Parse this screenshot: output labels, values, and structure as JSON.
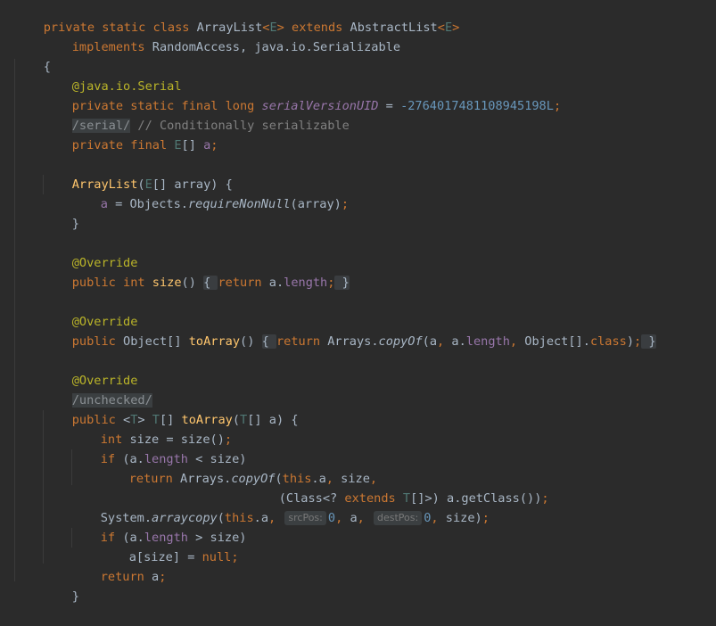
{
  "editor": {
    "language": "Java",
    "code": {
      "l1": {
        "kw1": "private static class ",
        "cls": "ArrayList",
        "gen_open": "<",
        "e": "E",
        "gen_close": "> ",
        "kw2": "extends ",
        "parent": "AbstractList",
        "gen_open2": "<",
        "e2": "E",
        "gen_close2": ">"
      },
      "l2": {
        "kw": "implements ",
        "rest": "RandomAccess, java.io.Serializable"
      },
      "l3": {
        "brace": "{"
      },
      "l4": {
        "ann": "@java.io.Serial"
      },
      "l5": {
        "kw": "private static final long ",
        "field": "serialVersionUID",
        "eq": " = ",
        "num": "-2764017481108945198L",
        "semi": ";"
      },
      "l6": {
        "sup": "/serial/",
        "comment": " // Conditionally serializable"
      },
      "l7": {
        "kw": "private final ",
        "e": "E",
        "brackets": "[] ",
        "field": "a",
        "semi": ";"
      },
      "l8": {
        "ctor": "ArrayList",
        "open": "(",
        "e": "E",
        "rest": "[] array) {"
      },
      "l9": {
        "field": "a",
        "mid": " = Objects.",
        "method": "requireNonNull",
        "rest": "(array)",
        "semi": ";"
      },
      "l10": {
        "brace": "}"
      },
      "l11": {
        "ann": "@Override"
      },
      "l12": {
        "kw": "public int ",
        "fn": "size",
        "paren": "() ",
        "fold1": "{ ",
        "kw2": "return ",
        "a": "a.",
        "length": "length",
        "semi": ";",
        "fold2": " }"
      },
      "l13": {
        "ann": "@Override"
      },
      "l14": {
        "kw": "public ",
        "type": "Object[] ",
        "fn": "toArray",
        "paren": "() ",
        "fold1": "{ ",
        "kw2": "return ",
        "cls": "Arrays.",
        "method": "copyOf",
        "args1": "(a",
        "comma1": ", ",
        "a2": "a.",
        "length": "length",
        "comma2": ", ",
        "obj": "Object[].",
        "classkw": "class",
        "close": ")",
        "semi": ";",
        "fold2": " }"
      },
      "l15": {
        "ann": "@Override"
      },
      "l16": {
        "sup": "/unchecked/"
      },
      "l17": {
        "kw": "public ",
        "open": "<",
        "t": "T",
        "close": "> ",
        "t2": "T",
        "rest1": "[] ",
        "fn": "toArray",
        "paren": "(",
        "t3": "T",
        "rest2": "[] a) {"
      },
      "l18": {
        "kw": "int ",
        "rest": "size = size()",
        "semi": ";"
      },
      "l19": {
        "kw": "if ",
        "rest1": "(a.",
        "length": "length",
        "rest2": " < size)"
      },
      "l20": {
        "kw": "return ",
        "cls": "Arrays.",
        "method": "copyOf",
        "open": "(",
        "this": "this",
        "rest1": ".a",
        "comma": ", ",
        "rest2": "size",
        "comma2": ","
      },
      "l21": {
        "rest1": "(Class<? ",
        "kw": "extends ",
        "t": "T",
        "rest2": "[]>) a.getClass())",
        "semi": ";"
      },
      "l22": {
        "cls": "System.",
        "method": "arraycopy",
        "open": "(",
        "this": "this",
        "rest1": ".a",
        "comma1": ", ",
        "hint1": "srcPos:",
        "n1": "0",
        "comma2": ", ",
        "a": "a",
        "comma3": ", ",
        "hint2": "destPos:",
        "n2": "0",
        "comma4": ", ",
        "size": "size)",
        "semi": ";"
      },
      "l23": {
        "kw": "if ",
        "rest1": "(a.",
        "length": "length",
        "rest2": " > size)"
      },
      "l24": {
        "rest": "a[size] = ",
        "kw": "null",
        "semi": ";"
      },
      "l25": {
        "kw": "return ",
        "rest": "a",
        "semi": ";"
      },
      "l26": {
        "brace": "}"
      }
    }
  },
  "colors": {
    "background": "#2b2b2b",
    "keyword": "#cc7832",
    "annotation": "#bbb529",
    "method": "#ffc66d",
    "field": "#9876aa",
    "number": "#6897bb",
    "comment": "#808080",
    "generic": "#507874",
    "text": "#a9b7c6"
  }
}
